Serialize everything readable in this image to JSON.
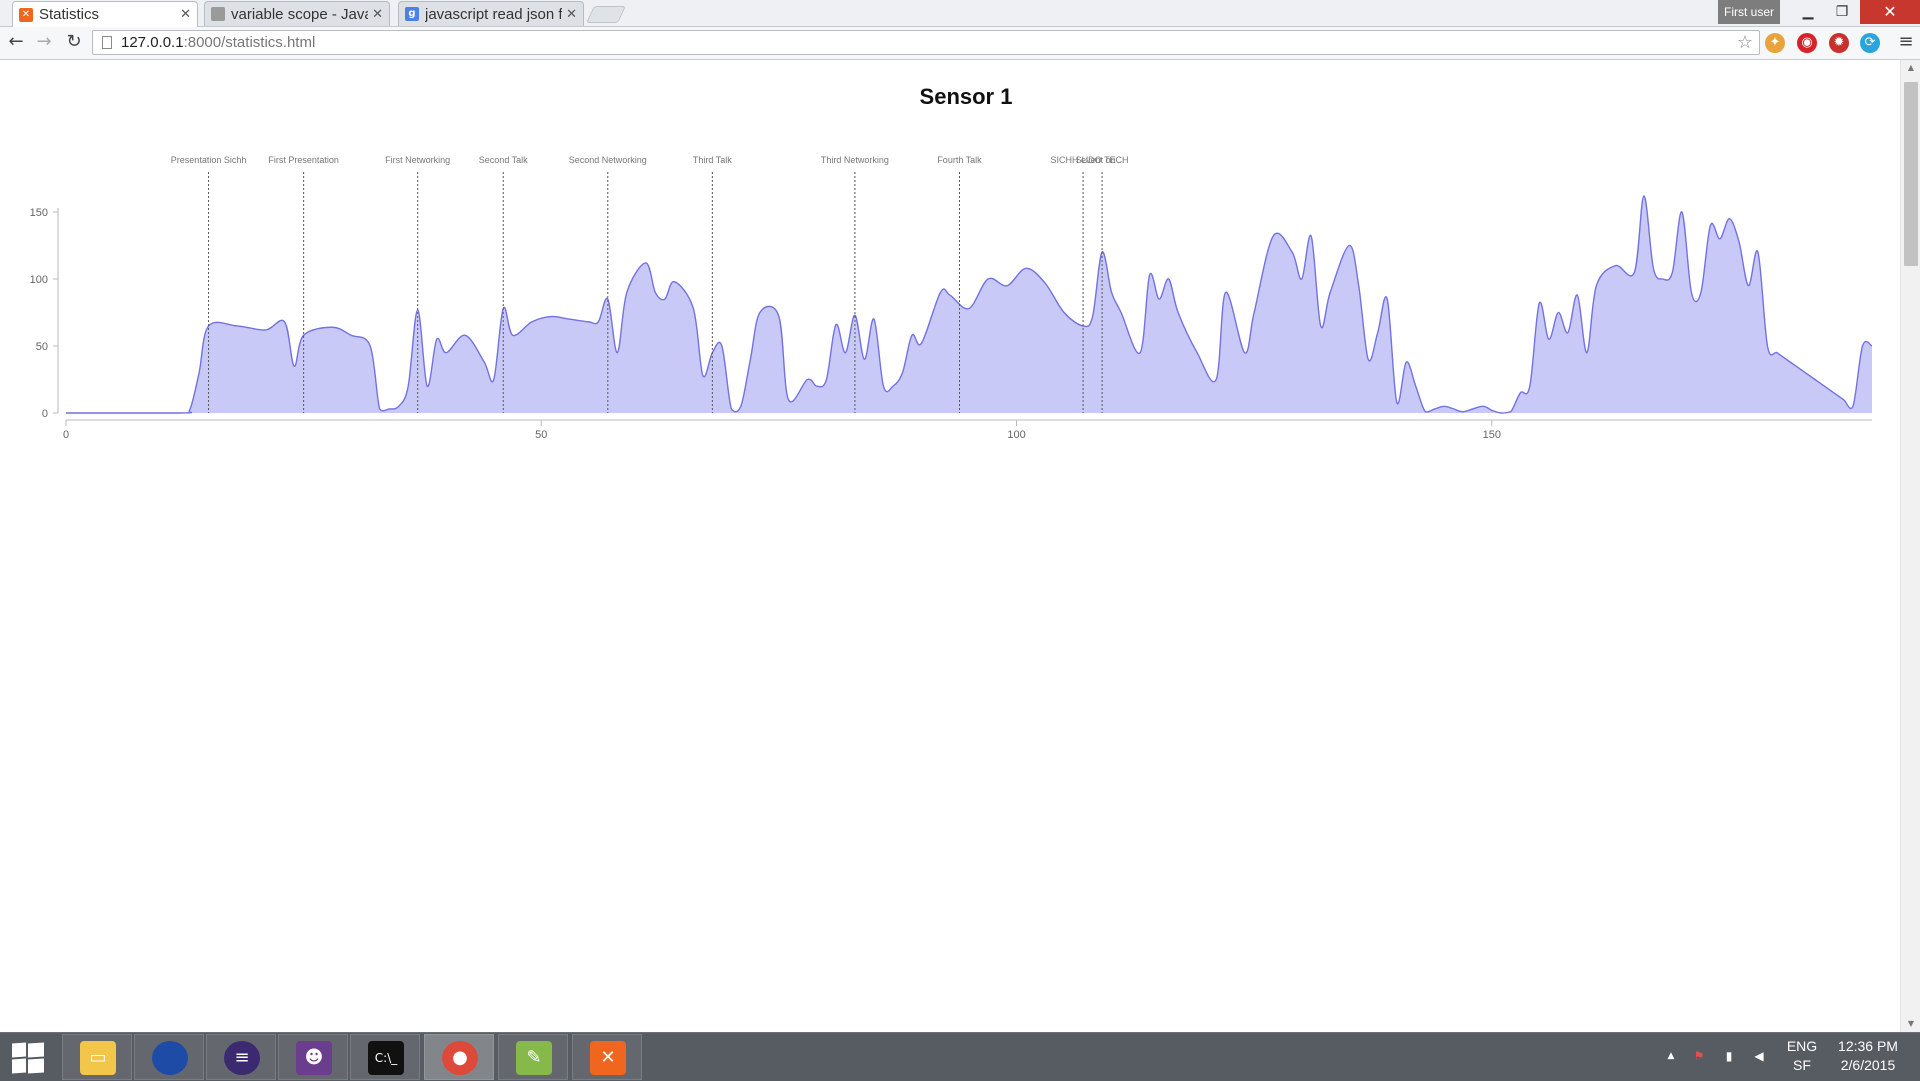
{
  "browser": {
    "tabs": [
      {
        "label": "Statistics",
        "active": true,
        "favicon": "xampp-icon",
        "favicon_color": "#f0661e"
      },
      {
        "label": "variable scope - Java",
        "active": false,
        "favicon": "stackoverflow-icon",
        "favicon_color": "#9a9a9a"
      },
      {
        "label": "javascript read json f",
        "active": false,
        "favicon": "google-icon",
        "favicon_color": "#4a80e8"
      }
    ],
    "user": "First user",
    "url": {
      "host": "127.0.0.1",
      "path": ":8000/statistics.html"
    }
  },
  "page": {
    "title": "Sensor 1"
  },
  "chart_data": {
    "type": "area",
    "title": "Sensor 1",
    "xlim": [
      0,
      190
    ],
    "ylim": [
      0,
      150
    ],
    "xticks": [
      0,
      50,
      100,
      150
    ],
    "yticks": [
      0,
      50,
      100,
      150
    ],
    "fill_color": "#c9c9f8",
    "line_color": "#7272e0",
    "event_line_color": "#555555",
    "events": [
      {
        "x": 15,
        "label": "Presentation Sichh"
      },
      {
        "x": 25,
        "label": "First Presentation"
      },
      {
        "x": 37,
        "label": "First Networking"
      },
      {
        "x": 46,
        "label": "Second Talk"
      },
      {
        "x": 57,
        "label": "Second Networking"
      },
      {
        "x": 68,
        "label": "Third Talk"
      },
      {
        "x": 83,
        "label": "Third Networking"
      },
      {
        "x": 94,
        "label": "Fourth Talk"
      },
      {
        "x": 107,
        "label": "SICHH event on"
      },
      {
        "x": 109,
        "label": "SUDO TECH"
      }
    ],
    "x": [
      0,
      12,
      13,
      14,
      15,
      18,
      21,
      23,
      24,
      25,
      28,
      30,
      32,
      33,
      34,
      35,
      36,
      37,
      38,
      39,
      40,
      42,
      44,
      45,
      46,
      47,
      49,
      51,
      53,
      55,
      56,
      57,
      58,
      59,
      61,
      62,
      63,
      64,
      66,
      67,
      68,
      69,
      70,
      71,
      72,
      73,
      75,
      76,
      78,
      79,
      80,
      81,
      82,
      83,
      84,
      85,
      86,
      87,
      88,
      89,
      90,
      92,
      93,
      95,
      97,
      99,
      101,
      103,
      105,
      107,
      108,
      109,
      110,
      111,
      113,
      114,
      115,
      116,
      117,
      119,
      121,
      122,
      124,
      125,
      127,
      129,
      130,
      131,
      132,
      133,
      135,
      136,
      137,
      138,
      139,
      140,
      141,
      142,
      143,
      144,
      145,
      146,
      147,
      149,
      150,
      151,
      152,
      153,
      154,
      155,
      156,
      157,
      158,
      159,
      160,
      161,
      163,
      165,
      166,
      167,
      168,
      169,
      170,
      171,
      172,
      173,
      174,
      175,
      176,
      177,
      178,
      179,
      180,
      181,
      182,
      183,
      184,
      185,
      186,
      187,
      188,
      189,
      190
    ],
    "y": [
      0,
      0,
      2,
      30,
      65,
      65,
      62,
      68,
      35,
      58,
      64,
      58,
      50,
      3,
      3,
      5,
      20,
      77,
      20,
      55,
      45,
      58,
      38,
      25,
      78,
      58,
      68,
      72,
      70,
      68,
      68,
      85,
      45,
      90,
      112,
      90,
      85,
      98,
      78,
      28,
      45,
      50,
      3,
      5,
      40,
      75,
      72,
      10,
      25,
      20,
      25,
      66,
      45,
      73,
      40,
      70,
      20,
      20,
      30,
      58,
      52,
      90,
      88,
      78,
      100,
      95,
      108,
      97,
      75,
      65,
      72,
      120,
      90,
      75,
      45,
      103,
      85,
      100,
      75,
      45,
      25,
      90,
      45,
      75,
      132,
      120,
      100,
      132,
      65,
      90,
      125,
      95,
      40,
      60,
      85,
      8,
      38,
      20,
      1,
      3,
      5,
      3,
      1,
      5,
      2,
      0,
      1,
      15,
      20,
      82,
      55,
      75,
      60,
      88,
      45,
      95,
      110,
      105,
      162,
      108,
      100,
      105,
      150,
      90,
      90,
      140,
      130,
      145,
      128,
      95,
      120,
      50,
      45,
      40,
      35,
      30,
      25,
      20,
      15,
      10,
      5,
      50,
      50
    ]
  },
  "taskbar": {
    "apps": [
      {
        "name": "file-explorer",
        "icon": "folder-icon",
        "color": "#f2c64b"
      },
      {
        "name": "sphere-app",
        "icon": "sphere-icon",
        "color": "#1d4ba5"
      },
      {
        "name": "eclipse",
        "icon": "eclipse-icon",
        "color": "#3b2a70"
      },
      {
        "name": "github",
        "icon": "github-icon",
        "color": "#6b3e8d"
      },
      {
        "name": "command-prompt",
        "icon": "terminal-icon",
        "color": "#111111"
      },
      {
        "name": "chrome",
        "icon": "chrome-icon",
        "color": "#dd4a3a",
        "active": true
      },
      {
        "name": "notepad-plus",
        "icon": "notepad-icon",
        "color": "#86b94a"
      },
      {
        "name": "xampp",
        "icon": "xampp-icon",
        "color": "#f0661e"
      }
    ],
    "lang": "ENG",
    "lang_sub": "SF",
    "time": "12:36 PM",
    "date": "2/6/2015"
  }
}
